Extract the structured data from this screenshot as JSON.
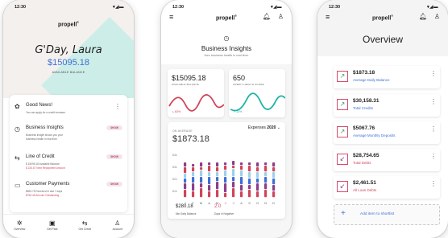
{
  "phone1": {
    "time": "12:30",
    "logo": "propell",
    "greeting": "G'Day, Laura",
    "balance": "$15095.18",
    "balance_label": "AVAILABLE BALANCE",
    "items": [
      {
        "icon": "ribbon-icon",
        "title": "Good News!",
        "lines": [
          "You can apply for a credit increase."
        ],
        "red_lines": [],
        "action": "⋮"
      },
      {
        "icon": "gauge-icon",
        "title": "Business Insights",
        "lines": [
          "Business insight shows you your",
          "business health in real time."
        ],
        "red_lines": [],
        "action": "SHOW"
      },
      {
        "icon": "transfer-icon",
        "title": "Line of Credit",
        "lines": [
          "$ 15095.18 Available Balance"
        ],
        "red_lines": [
          "$ 226.67 Next Repayment Amount"
        ],
        "action": "SHOW"
      },
      {
        "icon": "card-icon",
        "title": "Customer Payments",
        "lines": [
          "$653.75 Received in last 7 days"
        ],
        "red_lines": [
          "$766.46 Amount Outstanding"
        ],
        "action": "SHOW"
      }
    ],
    "tabs": [
      "Overview",
      "Get Paid",
      "Get Credit",
      "Account"
    ]
  },
  "phone2": {
    "time": "12:30",
    "logo": "propell",
    "title": "Business Insights",
    "subtitle": "Your business health in real time.",
    "card1": {
      "value": "$15095.18",
      "label": "AVAILABLE BALANCE",
      "change": "↘ 63%"
    },
    "card2": {
      "value": "650",
      "label": "CREDIT HEALTH SCORE",
      "change": "↗ 33%"
    },
    "expenses": {
      "avg_label": "ON AVERAGE",
      "avg_value": "$1873.18",
      "selector_label": "Expenses",
      "selector_year": "2020",
      "y_labels": [
        "$4k",
        "$3k",
        "$2k",
        "$1k"
      ],
      "months": [
        "J",
        "F",
        "M",
        "A",
        "M",
        "J",
        "J",
        "A",
        "S",
        "O",
        "N",
        "D"
      ]
    },
    "footer": {
      "value1": "$280.18",
      "label1": "Min Daily Balance",
      "value2": "2.0",
      "label2": "Days in Negative"
    }
  },
  "phone3": {
    "time": "12:30",
    "logo": "propell",
    "title": "Overview",
    "cards": [
      {
        "icon": "trend-up-icon",
        "value": "$1873.18",
        "label": "Average Daily Balance",
        "red": false
      },
      {
        "icon": "trend-up-icon",
        "value": "$30,158.31",
        "label": "Total Credits",
        "red": false
      },
      {
        "icon": "trend-up-icon",
        "value": "$5067.76",
        "label": "Average Monthly Deposits",
        "red": false
      },
      {
        "icon": "trend-down-icon",
        "value": "$28,754.65",
        "label": "Total Debts",
        "red": true
      },
      {
        "icon": "trend-down-icon",
        "value": "$2,461.51",
        "label": "All Loan Debts",
        "red": true
      }
    ],
    "add_label": "Add item to shortlist"
  }
}
